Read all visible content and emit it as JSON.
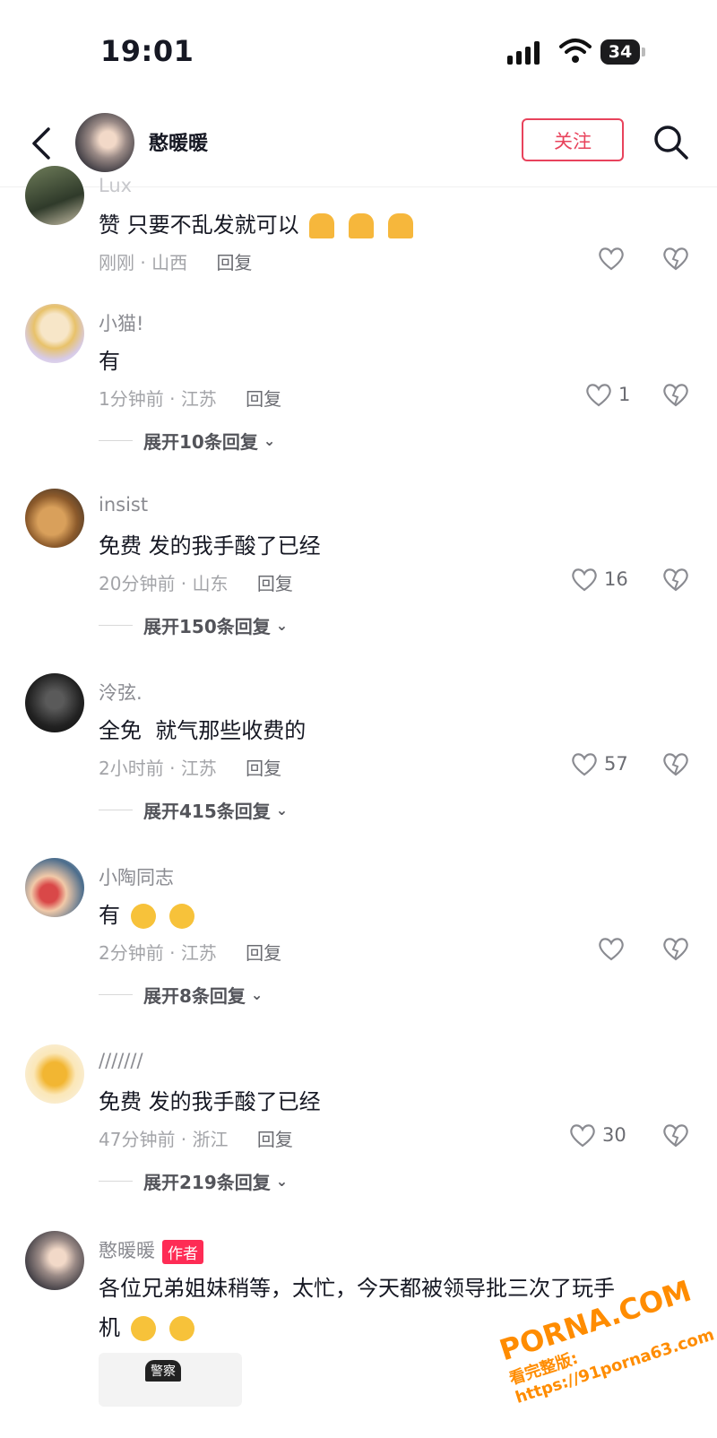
{
  "status_bar": {
    "time": "19:01",
    "battery": "34"
  },
  "header": {
    "name": "憨暖暖",
    "follow_label": "关注"
  },
  "comments": [
    {
      "user": "Lux",
      "text": "赞 只要不乱发就可以",
      "time": "刚刚",
      "region": "山西",
      "reply_label": "回复",
      "likes": "",
      "expand": ""
    },
    {
      "user": "小猫!",
      "text": "有",
      "time": "1分钟前",
      "region": "江苏",
      "reply_label": "回复",
      "likes": "1",
      "expand": "展开10条回复"
    },
    {
      "user": "insist",
      "text": "免费 发的我手酸了已经",
      "time": "20分钟前",
      "region": "山东",
      "reply_label": "回复",
      "likes": "16",
      "expand": "展开150条回复"
    },
    {
      "user": "泠弦.",
      "text": "全免  就气那些收费的",
      "time": "2小时前",
      "region": "江苏",
      "reply_label": "回复",
      "likes": "57",
      "expand": "展开415条回复"
    },
    {
      "user": "小陶同志",
      "text": "有",
      "time": "2分钟前",
      "region": "江苏",
      "reply_label": "回复",
      "likes": "",
      "expand": "展开8条回复"
    },
    {
      "user": "///////",
      "text": "免费 发的我手酸了已经",
      "time": "47分钟前",
      "region": "浙江",
      "reply_label": "回复",
      "likes": "30",
      "expand": "展开219条回复"
    },
    {
      "user": "憨暖暖",
      "author_tag": "作者",
      "text_line1": "各位兄弟姐妹稍等，太忙，今天都被领导批三次了玩手",
      "text_line2": "机"
    }
  ],
  "sticker_label": "警察",
  "watermark": {
    "line1": "PORNA.COM",
    "line2": "看完整版: https://91porna63.com"
  },
  "colors": {
    "accent": "#fe2c55",
    "follow_border": "#e8435c",
    "meta": "#a3a4a8"
  }
}
